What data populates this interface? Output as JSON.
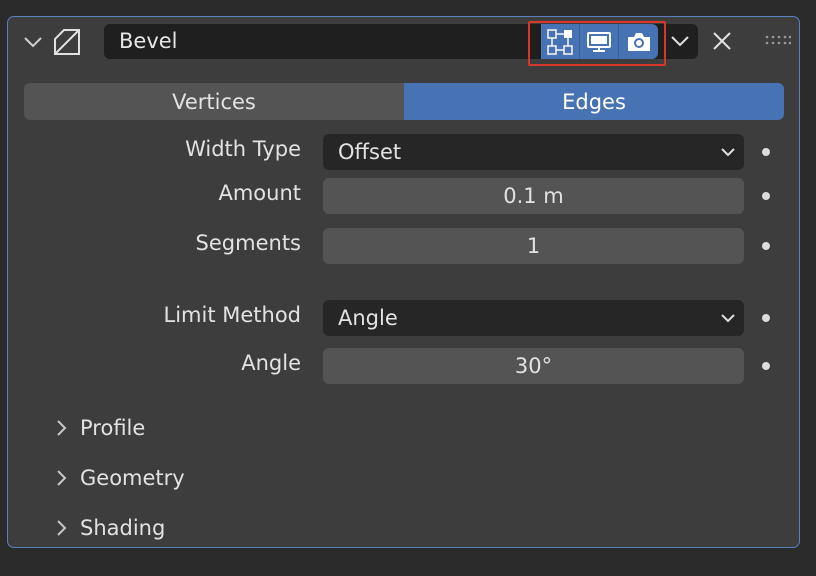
{
  "modifier": {
    "name": "Bevel",
    "icons": {
      "collapse": "chevron-down-icon",
      "type": "bevel-modifier-icon",
      "edit_mode": "edit-mode-icon",
      "realtime": "monitor-icon",
      "render": "camera-icon",
      "dropdown": "chevron-down-icon",
      "close": "close-icon",
      "drag": "drag-handle-icon"
    }
  },
  "tabs": [
    {
      "label": "Vertices",
      "active": false
    },
    {
      "label": "Edges",
      "active": true
    }
  ],
  "properties": {
    "width_type": {
      "label": "Width Type",
      "value": "Offset"
    },
    "amount": {
      "label": "Amount",
      "value": "0.1 m"
    },
    "segments": {
      "label": "Segments",
      "value": "1"
    },
    "limit_method": {
      "label": "Limit Method",
      "value": "Angle"
    },
    "angle": {
      "label": "Angle",
      "value": "30°"
    }
  },
  "subpanels": [
    {
      "label": "Profile"
    },
    {
      "label": "Geometry"
    },
    {
      "label": "Shading"
    }
  ],
  "colors": {
    "accent": "#4772b3",
    "panel_border": "#5a80c0",
    "highlight": "#d9372a"
  }
}
